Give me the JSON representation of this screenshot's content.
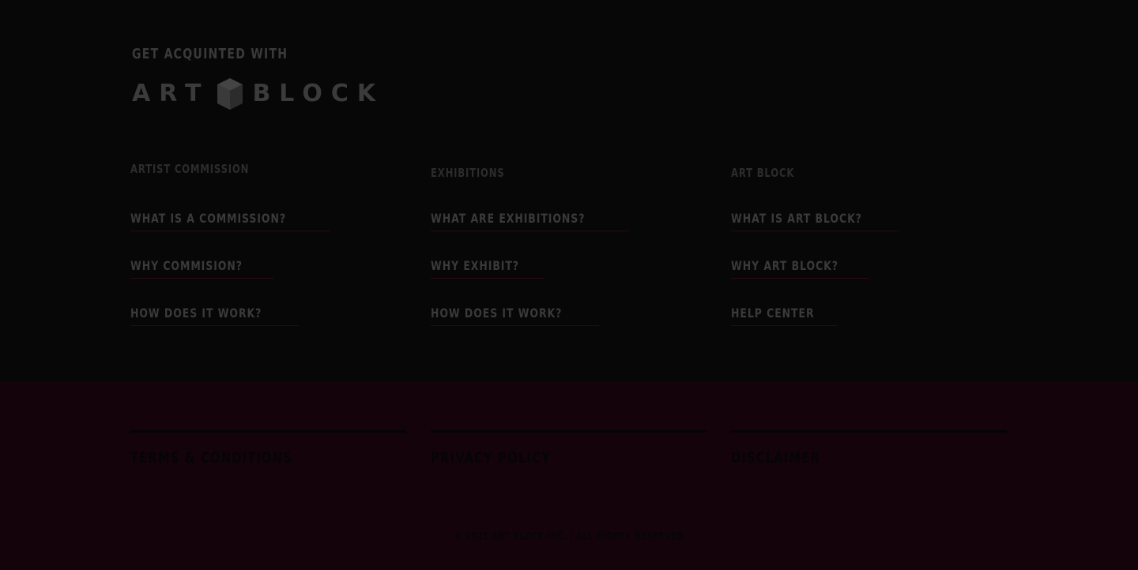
{
  "intro": {
    "text": "GET ACQUINTED WITH"
  },
  "logo": {
    "left_word": "ART",
    "right_word": "BLOCK",
    "cube_icon": "cube-icon"
  },
  "columns": [
    {
      "title": "ARTIST COMMISSION",
      "links": [
        "WHAT IS A COMMISSION?",
        "WHY COMMISION?",
        "HOW DOES IT WORK?"
      ]
    },
    {
      "title": "EXHIBITIONS",
      "links": [
        "WHAT ARE EXHIBITIONS?",
        "WHY EXHIBIT?",
        "HOW DOES IT WORK?"
      ]
    },
    {
      "title": "ART BLOCK",
      "links": [
        "WHAT IS ART BLOCK?",
        "WHY ART BLOCK?",
        "HELP CENTER"
      ]
    }
  ],
  "legal": [
    {
      "label": "TERMS & CONDITIONS"
    },
    {
      "label": "PRIVACY POLICY"
    },
    {
      "label": "DISCLAIMER"
    }
  ],
  "copyright": "© 2021 ART BLOCK INC. | ALL RIGHTS RESERVED",
  "colors": {
    "top_background": "#070707",
    "bottom_background": "#14030b",
    "text_dim": "#3a3a3a",
    "link_underline": "#2a0a14"
  }
}
